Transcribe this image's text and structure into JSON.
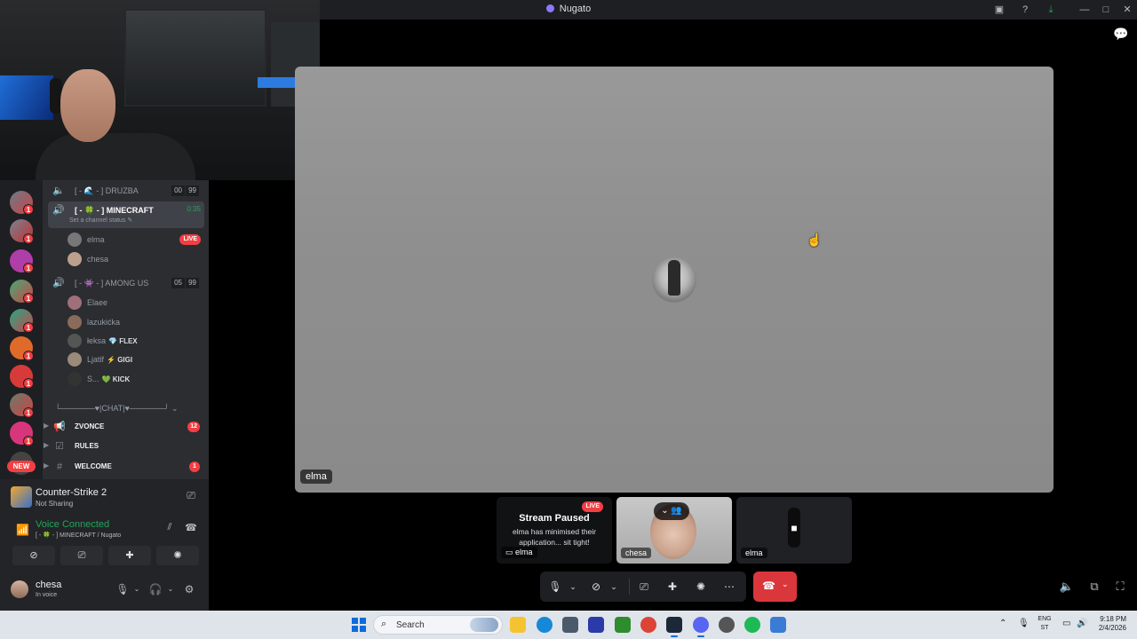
{
  "window": {
    "title": "Nugato"
  },
  "webcam": {
    "description": ""
  },
  "rail": {
    "badges": [
      "1",
      "1",
      "1",
      "1",
      "1",
      "1",
      "1",
      "1",
      "1",
      "1"
    ],
    "new_label": "NEW"
  },
  "channels": {
    "voice": [
      {
        "name": "[ - 🌊 - ] DRUZBA",
        "count_a": "00",
        "count_b": "99"
      },
      {
        "name": "[ - 🍀 - ] MINECRAFT",
        "time": "0:35",
        "status": "Set a channel status ✎"
      },
      {
        "name": "[ - 👾 - ] AMONG US",
        "count_a": "05",
        "count_b": "99"
      }
    ],
    "minecraft_users": [
      {
        "name": "elma",
        "live": "LIVE"
      },
      {
        "name": "chesa"
      }
    ],
    "among_users": [
      {
        "name": "Elaee",
        "tag": ""
      },
      {
        "name": "lazukićka",
        "tag": ""
      },
      {
        "name": "łeksa",
        "tag": "💎 FLEX"
      },
      {
        "name": "Ljatif",
        "tag": "⚡ GIGI"
      },
      {
        "name": "S...",
        "tag": "💚 KICK"
      }
    ],
    "category": "└──────♥|CHAT|♥──────┘ ⌄",
    "text": [
      {
        "name": "ZVONCE",
        "badge": "12"
      },
      {
        "name": "RULES",
        "badge": ""
      },
      {
        "name": "WELCOME",
        "badge": "1"
      }
    ]
  },
  "panel": {
    "activity_title": "Counter-Strike 2",
    "activity_sub": "Not Sharing",
    "voice_title": "Voice Connected",
    "voice_sub": "[ - 🍀 - ] MINECRAFT / Nugato",
    "username": "chesa",
    "user_status": "In voice"
  },
  "stage": {
    "label": "elma"
  },
  "tiles": [
    {
      "title": "Stream Paused",
      "text": "elma has minimised their application... sit tight!",
      "label": "elma",
      "live": "LIVE"
    },
    {
      "label": "chesa"
    },
    {
      "label": "elma"
    }
  ],
  "taskbar": {
    "search_placeholder": "Search",
    "lang": "ENG",
    "lang_sub": "ST",
    "time": "9:18 PM",
    "date": "2/4/2026"
  },
  "colors": {
    "accent_green": "#23a55a",
    "live_red": "#f23f43",
    "hangup_red": "#da373c"
  }
}
